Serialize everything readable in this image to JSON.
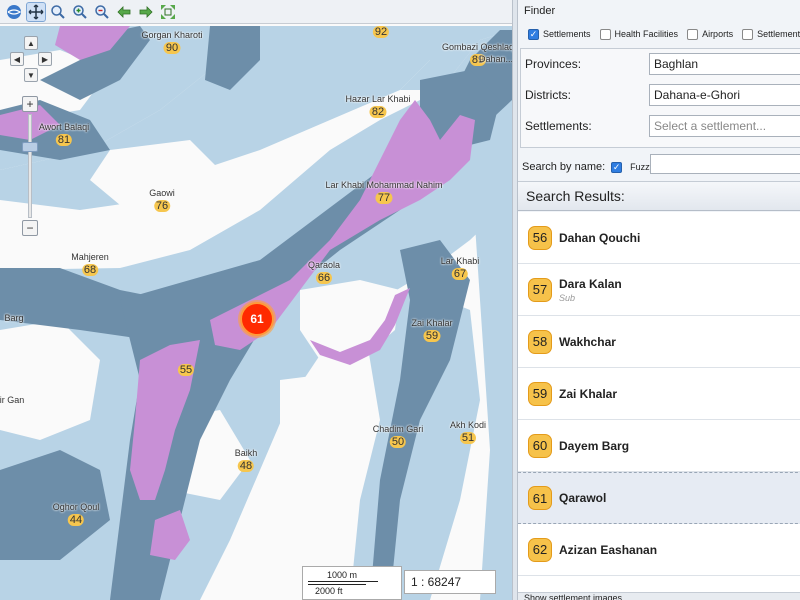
{
  "map": {
    "toolbar": [
      "globe-icon",
      "pan-icon",
      "zoom-box-icon",
      "zoom-in-icon",
      "zoom-out-icon",
      "back-arrow-icon",
      "forward-arrow-icon",
      "full-extent-icon"
    ],
    "places": [
      {
        "name": "Gorgan Kharoti",
        "num": "90"
      },
      {
        "name": "",
        "num": "92"
      },
      {
        "name": "Gombazi Qeshlaq",
        "num": "89"
      },
      {
        "name": "Dahan...",
        "num": ""
      },
      {
        "name": "Hazar Lar Khabi",
        "num": "82"
      },
      {
        "name": "Awort Balaqi",
        "num": "81"
      },
      {
        "name": "Lar Khabi Mohammad Nahim",
        "num": "77"
      },
      {
        "name": "Gaowi",
        "num": "76"
      },
      {
        "name": "Mahjeren",
        "num": "68"
      },
      {
        "name": "Qaraola",
        "num": "66"
      },
      {
        "name": "Lar Khabi",
        "num": "67"
      },
      {
        "name": "Barg",
        "num": ""
      },
      {
        "name": "Zai Khalar",
        "num": "59"
      },
      {
        "name": "",
        "num": "55"
      },
      {
        "name": "ir Gan",
        "num": ""
      },
      {
        "name": "Chadim Gari",
        "num": "50"
      },
      {
        "name": "Akh Kodi",
        "num": "51"
      },
      {
        "name": "Baikh",
        "num": "48"
      },
      {
        "name": "Oghor Qoul",
        "num": "44"
      }
    ],
    "selected_marker": "61",
    "scale": {
      "metric": "1000 m",
      "imperial": "2000 ft",
      "ratio": "1 : 68247"
    },
    "colors": {
      "land": "#fafafa",
      "light_blue": "#b8d3e6",
      "dark_blue": "#6d8ea9",
      "purple": "#c890d6",
      "marker": "#ff2a00",
      "badge": "#f6c64e"
    }
  },
  "finder": {
    "title": "Finder",
    "layers": [
      {
        "label": "Settlements",
        "checked": true
      },
      {
        "label": "Health Facilities",
        "checked": false
      },
      {
        "label": "Airports",
        "checked": false
      },
      {
        "label": "Settlements",
        "checked": false
      }
    ],
    "provinces_label": "Provinces:",
    "provinces_value": "Baghlan",
    "districts_label": "Districts:",
    "districts_value": "Dahana-e-Ghori",
    "settlements_label": "Settlements:",
    "settlements_placeholder": "Select a settlement...",
    "search_label": "Search by name:",
    "fuzzy_label": "Fuzzy",
    "fuzzy_checked": true,
    "search_value": ""
  },
  "results": {
    "header": "Search Results:",
    "items": [
      {
        "num": "56",
        "name": "Dahan Qouchi",
        "sub": ""
      },
      {
        "num": "57",
        "name": "Dara Kalan",
        "sub": "Sub"
      },
      {
        "num": "58",
        "name": "Wakhchar",
        "sub": ""
      },
      {
        "num": "59",
        "name": "Zai Khalar",
        "sub": ""
      },
      {
        "num": "60",
        "name": "Dayem Barg",
        "sub": ""
      },
      {
        "num": "61",
        "name": "Qarawol",
        "sub": "",
        "selected": true
      },
      {
        "num": "62",
        "name": "Azizan Eashanan",
        "sub": ""
      }
    ],
    "footer": "Show settlement images"
  }
}
